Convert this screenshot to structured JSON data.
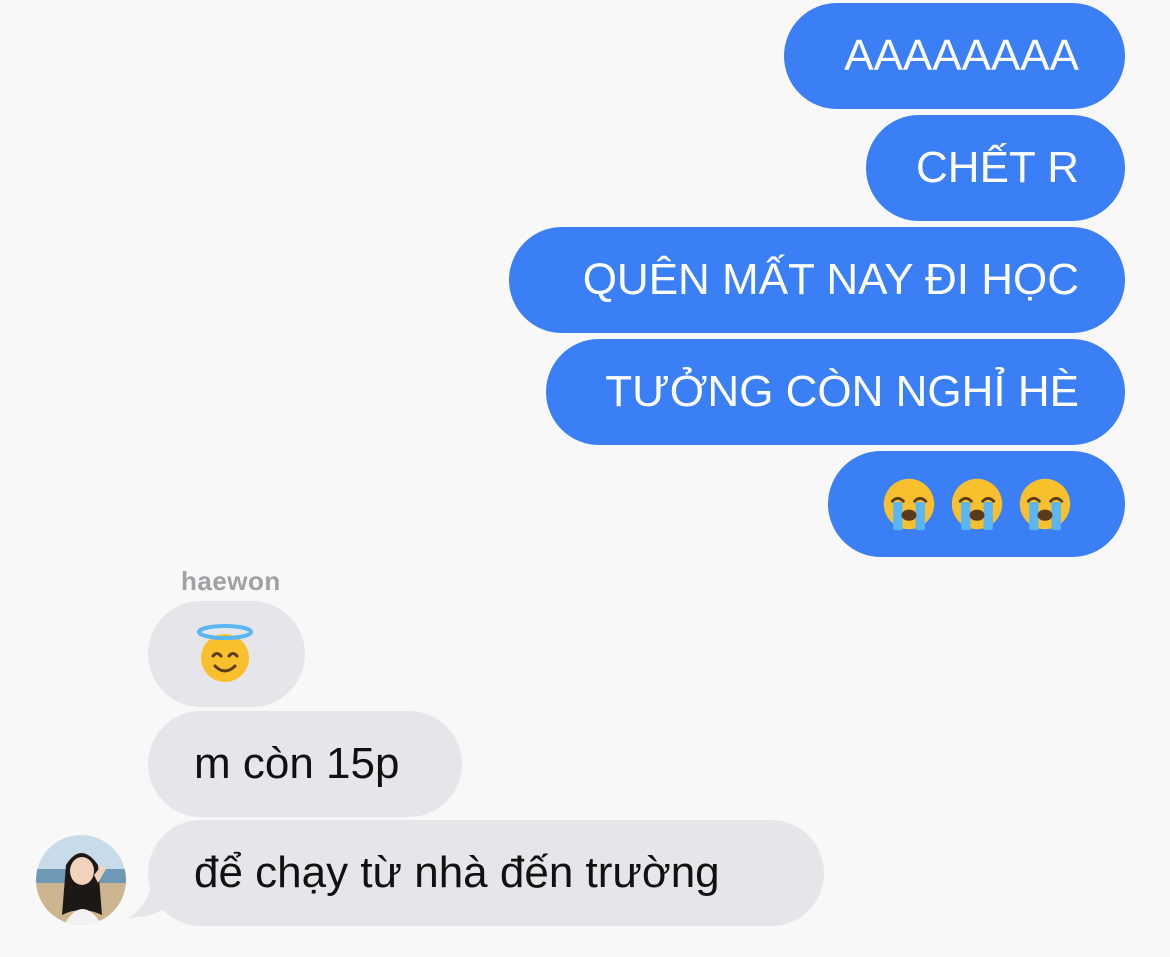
{
  "conversation": {
    "sent": [
      {
        "text": "AAAAAAAA"
      },
      {
        "text": "CHẾT R"
      },
      {
        "text": "QUÊN MẤT NAY ĐI HỌC"
      },
      {
        "text": "TƯỞNG CÒN NGHỈ HÈ"
      }
    ],
    "sent_emoji": {
      "icon": "loudly-crying-face-icon",
      "count": 3
    },
    "received": {
      "sender": "haewon",
      "emoji": {
        "icon": "smiling-face-with-halo-icon"
      },
      "messages": [
        {
          "text": "m còn 15p"
        },
        {
          "text": "để chạy từ nhà đến trường"
        }
      ],
      "avatar": {
        "icon": "contact-avatar-photo"
      }
    }
  },
  "colors": {
    "background": "#f8f8f8",
    "sent_bubble": "#3b7ff6",
    "received_bubble": "#e6e5ea",
    "sender_label": "#a0a0a5"
  }
}
